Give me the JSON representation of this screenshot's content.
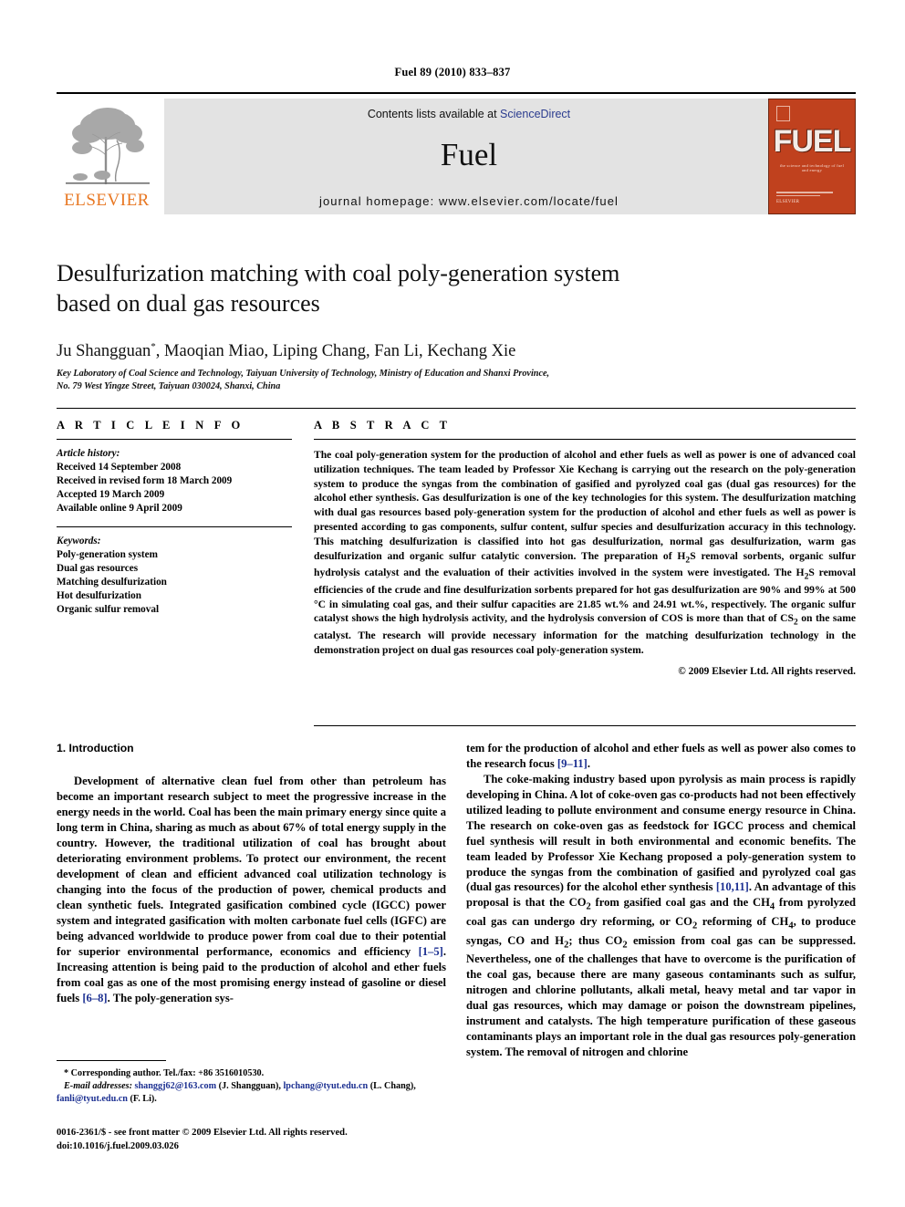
{
  "running_head": "Fuel 89 (2010) 833–837",
  "masthead": {
    "publisher": "ELSEVIER",
    "contents_prefix": "Contents lists available at ",
    "contents_link": "ScienceDirect",
    "journal_name": "Fuel",
    "homepage": "journal homepage: www.elsevier.com/locate/fuel",
    "cover_title": "FUEL",
    "cover_tagline": "the science and technology of fuel and energy",
    "cover_publisher": "ELSEVIER",
    "accent_color": "#E87722",
    "link_color": "#2b3c8f",
    "cover_color": "#c0411e"
  },
  "article": {
    "title_line1": "Desulfurization matching with coal poly-generation system",
    "title_line2": "based on dual gas resources",
    "authors": "Ju Shangguan",
    "authors_rest": ", Maoqian Miao, Liping Chang, Fan Li, Kechang Xie",
    "corresponding_marker": "*",
    "affiliation_line1": "Key Laboratory of Coal Science and Technology, Taiyuan University of Technology, Ministry of Education and Shanxi Province,",
    "affiliation_line2": "No. 79 West Yingze Street, Taiyuan 030024, Shanxi, China"
  },
  "article_info": {
    "heading": "A R T I C L E    I N F O",
    "history_label": "Article history:",
    "history": [
      "Received 14 September 2008",
      "Received in revised form 18 March 2009",
      "Accepted 19 March 2009",
      "Available online 9 April 2009"
    ],
    "keywords_label": "Keywords:",
    "keywords": [
      "Poly-generation system",
      "Dual gas resources",
      "Matching desulfurization",
      "Hot desulfurization",
      "Organic sulfur removal"
    ]
  },
  "abstract": {
    "heading": "A B S T R A C T",
    "text": "The coal poly-generation system for the production of alcohol and ether fuels as well as power is one of advanced coal utilization techniques. The team leaded by Professor Xie Kechang is carrying out the research on the poly-generation system to produce the syngas from the combination of gasified and pyrolyzed coal gas (dual gas resources) for the alcohol ether synthesis. Gas desulfurization is one of the key technologies for this system. The desulfurization matching with dual gas resources based poly-generation system for the production of alcohol and ether fuels as well as power is presented according to gas components, sulfur content, sulfur species and desulfurization accuracy in this technology. This matching desulfurization is classified into hot gas desulfurization, normal gas desulfurization, warm gas desulfurization and organic sulfur catalytic conversion. The preparation of H2S removal sorbents, organic sulfur hydrolysis catalyst and the evaluation of their activities involved in the system were investigated. The H2S removal efficiencies of the crude and fine desulfurization sorbents prepared for hot gas desulfurization are 90% and 99% at 500 °C in simulating coal gas, and their sulfur capacities are 21.85 wt.% and 24.91 wt.%, respectively. The organic sulfur catalyst shows the high hydrolysis activity, and the hydrolysis conversion of COS is more than that of CS2 on the same catalyst. The research will provide necessary information for the matching desulfurization technology in the demonstration project on dual gas resources coal poly-generation system.",
    "copyright": "© 2009 Elsevier Ltd. All rights reserved."
  },
  "body": {
    "section_title": "1. Introduction",
    "left_para1": "Development of alternative clean fuel from other than petroleum has become an important research subject to meet the progressive increase in the energy needs in the world. Coal has been the main primary energy since quite a long term in China, sharing as much as about 67% of total energy supply in the country. However, the traditional utilization of coal has brought about deteriorating environment problems. To protect our environment, the recent development of clean and efficient advanced coal utilization technology is changing into the focus of the production of power, chemical products and clean synthetic fuels. Integrated gasification combined cycle (IGCC) power system and integrated gasification with molten carbonate fuel cells (IGFC) are being advanced worldwide to produce power from coal due to their potential for superior environmental performance, economics and efficiency ",
    "left_ref1": "[1–5]",
    "left_para1_cont": ". Increasing attention is being paid to the production of alcohol and ether fuels from coal gas as one of the most promising energy instead of gasoline or diesel fuels ",
    "left_ref2": "[6–8]",
    "left_para1_end": ". The poly-generation sys-",
    "right_para1_start": "tem for the production of alcohol and ether fuels as well as power also comes to the research focus ",
    "right_ref1": "[9–11]",
    "right_para1_end": ".",
    "right_para2_start": "The coke-making industry based upon pyrolysis as main process is rapidly developing in China. A lot of coke-oven gas co-products had not been effectively utilized leading to pollute environment and consume energy resource in China. The research on coke-oven gas as feedstock for IGCC process and chemical fuel synthesis will result in both environmental and economic benefits. The team leaded by Professor Xie Kechang proposed a poly-generation system to produce the syngas from the combination of gasified and pyrolyzed coal gas (dual gas resources) for the alcohol ether synthesis ",
    "right_ref2": "[10,11]",
    "right_para2_end": ". An advantage of this proposal is that the CO2 from gasified coal gas and the CH4 from pyrolyzed coal gas can undergo dry reforming, or CO2 reforming of CH4, to produce syngas, CO and H2; thus CO2 emission from coal gas can be suppressed. Nevertheless, one of the challenges that have to overcome is the purification of the coal gas, because there are many gaseous contaminants such as sulfur, nitrogen and chlorine pollutants, alkali metal, heavy metal and tar vapor in dual gas resources, which may damage or poison the downstream pipelines, instrument and catalysts. The high temperature purification of these gaseous contaminants plays an important role in the dual gas resources poly-generation system. The removal of nitrogen and chlorine"
  },
  "footnote": {
    "corresponding": "Corresponding author. Tel./fax: +86 3516010530.",
    "email_label": "E-mail addresses:",
    "email1": "shanggj62@163.com",
    "email1_owner": " (J. Shangguan), ",
    "email2": "lpchang@tyut.edu.cn",
    "email2_owner": " (L. Chang), ",
    "email3": "fanli@tyut.edu.cn",
    "email3_owner": " (F. Li)."
  },
  "imprint": {
    "line1": "0016-2361/$ - see front matter © 2009 Elsevier Ltd. All rights reserved.",
    "line2": "doi:10.1016/j.fuel.2009.03.026"
  }
}
